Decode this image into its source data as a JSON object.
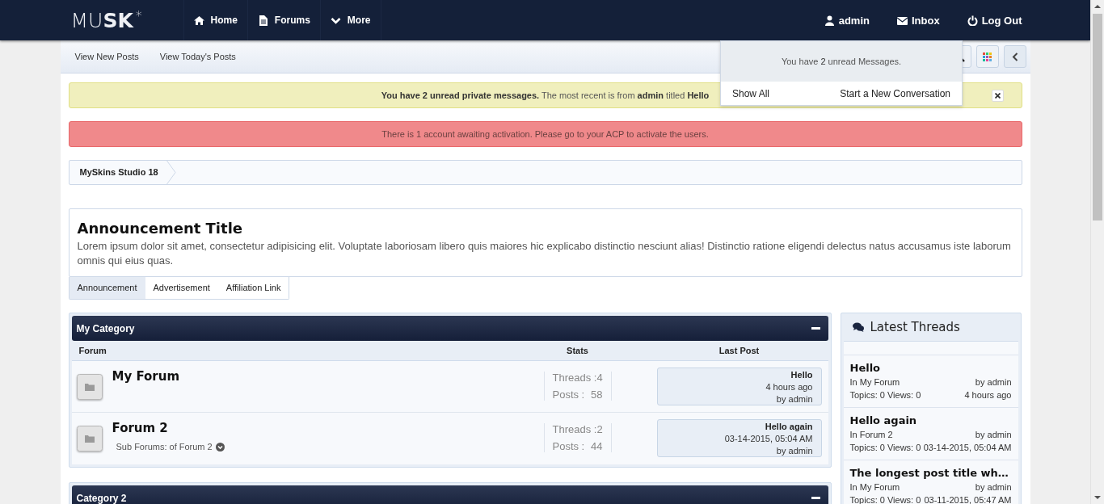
{
  "navbar": {
    "logo": "MU**SK**$^{*}$",
    "links": [
      {
        "label": "Home"
      },
      {
        "label": "Forums"
      },
      {
        "label": "More"
      }
    ],
    "user_links": [
      {
        "label": "admin"
      },
      {
        "label": "Inbox"
      },
      {
        "label": "Log Out"
      }
    ]
  },
  "subnav": {
    "links": [
      "View New Posts",
      "View Today's Posts"
    ]
  },
  "messages_popup": {
    "text": "You have **2** unread Messages.",
    "actions": [
      "Show All",
      "Start a New Conversation"
    ]
  },
  "alerts": [
    {
      "kind": "notice",
      "text": "**You have 2 unread private messages.** The most recent is from **admin** titled **Hello**",
      "closable": true
    },
    {
      "kind": "error",
      "text": "There is 1 account awaiting activation. Please go to your ACP to activate the users.",
      "closable": false
    }
  ],
  "breadcrumb": [
    "MySkins Studio 18"
  ],
  "announcement": {
    "title": "Announcement Title",
    "body": "Lorem ipsum dolor sit amet, consectetur adipisicing elit. Voluptate laboriosam libero quis maiores hic explicabo distinctio nesciunt alias! Distinctio ratione eligendi delectus natus accusamus iste laborum omnis qui eius quas.",
    "tabs": [
      {
        "label": "Announcement",
        "selected": true
      },
      {
        "label": "Advertisement",
        "selected": false
      },
      {
        "label": "Affiliation Link",
        "selected": false
      }
    ]
  },
  "categories": [
    {
      "title": "My Category",
      "columns": [
        "Forum",
        "Stats",
        "Last Post"
      ],
      "forums": [
        {
          "name": "My Forum",
          "threads": "Threads :4",
          "posts_label": "Posts :",
          "posts": "58",
          "last_post": {
            "title": "Hello",
            "time": "4 hours ago",
            "by": "by admin"
          }
        },
        {
          "name": "Forum 2",
          "subforums": "Sub Forums: of Forum 2",
          "threads": "Threads :2",
          "posts_label": "Posts :",
          "posts": "44",
          "last_post": {
            "title": "Hello again",
            "time": "03-14-2015, 05:04 AM",
            "by": "by admin"
          }
        }
      ]
    },
    {
      "title": "Category 2"
    }
  ],
  "latest_threads": {
    "title": "Latest Threads",
    "threads": [
      {
        "title": "Hello",
        "forum": "In My Forum",
        "by": "by admin",
        "stats": "Topics: 0 Views: 0",
        "time": "4 hours ago"
      },
      {
        "title": "Hello again",
        "forum": "In Forum 2",
        "by": "by admin",
        "stats": "Topics: 0 Views: 0",
        "time": "03-14-2015, 05:04 AM"
      },
      {
        "title": "The longest post title wh…",
        "forum": "In My Forum",
        "by": "by admin",
        "stats": "Topics: 0 Views: 0",
        "time": "03-11-2015, 05:47 AM"
      }
    ]
  }
}
